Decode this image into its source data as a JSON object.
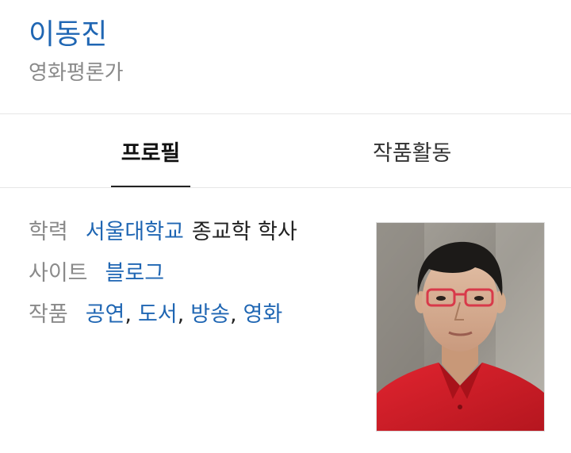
{
  "person": {
    "name": "이동진",
    "job": "영화평론가"
  },
  "tabs": [
    {
      "label": "프로필",
      "active": true
    },
    {
      "label": "작품활동",
      "active": false
    }
  ],
  "profile": {
    "education": {
      "label": "학력",
      "school": "서울대학교",
      "degree": "종교학 학사"
    },
    "site": {
      "label": "사이트",
      "link": "블로그"
    },
    "works": {
      "label": "작품",
      "items": [
        "공연",
        "도서",
        "방송",
        "영화"
      ],
      "separator": ","
    }
  },
  "colors": {
    "link": "#1f66b3",
    "label": "#8a8a8a",
    "shirt": "#d4202a"
  }
}
